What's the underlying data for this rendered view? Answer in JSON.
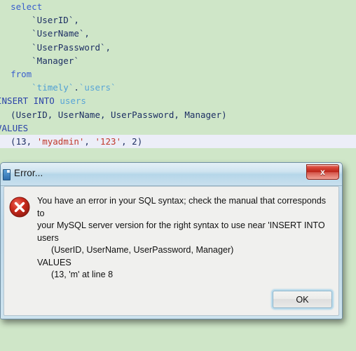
{
  "editor": {
    "lines": [
      {
        "indent": 0,
        "tokens": [
          {
            "text": "  ",
            "type": "plain"
          },
          {
            "text": "select",
            "type": "kw"
          }
        ]
      },
      {
        "indent": 0,
        "tokens": [
          {
            "text": "      ",
            "type": "plain"
          },
          {
            "text": "`UserID`",
            "type": "ident"
          },
          {
            "text": ",",
            "type": "plain"
          }
        ]
      },
      {
        "indent": 0,
        "tokens": [
          {
            "text": "      ",
            "type": "plain"
          },
          {
            "text": "`UserName`",
            "type": "ident"
          },
          {
            "text": ",",
            "type": "plain"
          }
        ]
      },
      {
        "indent": 0,
        "tokens": [
          {
            "text": "      ",
            "type": "plain"
          },
          {
            "text": "`UserPassword`",
            "type": "ident"
          },
          {
            "text": ",",
            "type": "plain"
          }
        ]
      },
      {
        "indent": 0,
        "tokens": [
          {
            "text": "      ",
            "type": "plain"
          },
          {
            "text": "`Manager`",
            "type": "ident"
          }
        ]
      },
      {
        "indent": 0,
        "tokens": [
          {
            "text": "  ",
            "type": "plain"
          },
          {
            "text": "from",
            "type": "kw"
          }
        ]
      },
      {
        "indent": 0,
        "tokens": [
          {
            "text": "      ",
            "type": "plain"
          },
          {
            "text": "`timely`",
            "type": "db"
          },
          {
            "text": ".",
            "type": "plain"
          },
          {
            "text": "`users`",
            "type": "table"
          }
        ]
      },
      {
        "indent": 0,
        "clipped": true,
        "tokens": [
          {
            "text": "INSERT INTO",
            "type": "kw-strong"
          },
          {
            "text": " ",
            "type": "plain"
          },
          {
            "text": "users",
            "type": "table"
          }
        ]
      },
      {
        "indent": 0,
        "tokens": [
          {
            "text": "  (UserID, UserName, UserPassword, Manager)",
            "type": "plain"
          }
        ]
      },
      {
        "indent": 0,
        "clipped": true,
        "tokens": [
          {
            "text": "VALUES",
            "type": "kw-strong"
          }
        ]
      },
      {
        "indent": 0,
        "current": true,
        "tokens": [
          {
            "text": "  (13, ",
            "type": "plain"
          },
          {
            "text": "'myadmin'",
            "type": "str"
          },
          {
            "text": ", ",
            "type": "plain"
          },
          {
            "text": "'123'",
            "type": "str"
          },
          {
            "text": ", 2)",
            "type": "plain"
          }
        ]
      }
    ]
  },
  "dialog": {
    "title": "Error...",
    "title_icon": "document-icon",
    "close_label": "x",
    "error_icon": "error-circle-x-icon",
    "message_lines": [
      {
        "text": "You have an error in your SQL syntax; check the manual that corresponds to",
        "indent": false
      },
      {
        "text": "your MySQL server version for the right syntax to use near 'INSERT INTO",
        "indent": false
      },
      {
        "text": "users",
        "indent": false
      },
      {
        "text": "(UserID, UserName, UserPassword, Manager)",
        "indent": true
      },
      {
        "text": "VALUES",
        "indent": false
      },
      {
        "text": "(13, 'm' at line 8",
        "indent": true
      }
    ],
    "ok_label": "OK"
  },
  "colors": {
    "editor_background": "#cfe6c8",
    "current_line": "#eceef8",
    "keyword": "#3a5fcd",
    "identifier": "#1d2f63",
    "table": "#5aa5d6",
    "string": "#c0392b",
    "error_red": "#c0281c",
    "titlebar_blue": "#bcd8ea"
  }
}
